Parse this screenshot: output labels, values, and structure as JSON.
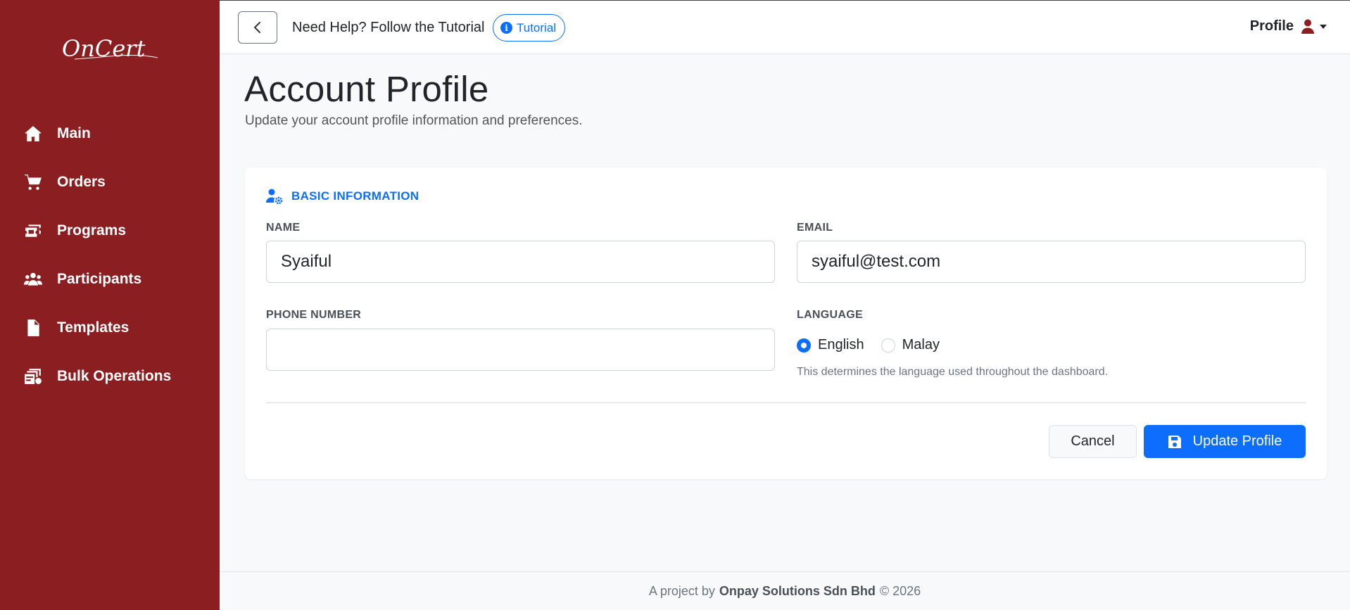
{
  "brand": {
    "logo_text": "OnCert"
  },
  "sidebar": {
    "items": [
      {
        "label": "Main",
        "icon": "home-icon"
      },
      {
        "label": "Orders",
        "icon": "cart-icon"
      },
      {
        "label": "Programs",
        "icon": "tickets-icon"
      },
      {
        "label": "Participants",
        "icon": "users-icon"
      },
      {
        "label": "Templates",
        "icon": "file-icon"
      },
      {
        "label": "Bulk Operations",
        "icon": "layers-icon"
      }
    ]
  },
  "topbar": {
    "help_text": "Need Help? Follow the Tutorial",
    "tutorial_label": "Tutorial",
    "profile_label": "Profile"
  },
  "page": {
    "title": "Account Profile",
    "subtitle": "Update your account profile information and preferences."
  },
  "form": {
    "section_title": "BASIC INFORMATION",
    "name": {
      "label": "NAME",
      "value": "Syaiful"
    },
    "email": {
      "label": "EMAIL",
      "value": "syaiful@test.com"
    },
    "phone": {
      "label": "PHONE NUMBER",
      "value": ""
    },
    "language": {
      "label": "LANGUAGE",
      "options": [
        "English",
        "Malay"
      ],
      "selected": "English",
      "help": "This determines the language used throughout the dashboard."
    },
    "cancel_label": "Cancel",
    "update_label": "Update Profile"
  },
  "footer": {
    "prefix": "A project by",
    "company": "Onpay Solutions Sdn Bhd",
    "suffix": "© 2026"
  },
  "colors": {
    "sidebar": "#8b1e20",
    "primary": "#0d6efd",
    "background": "#f8f9fa"
  }
}
